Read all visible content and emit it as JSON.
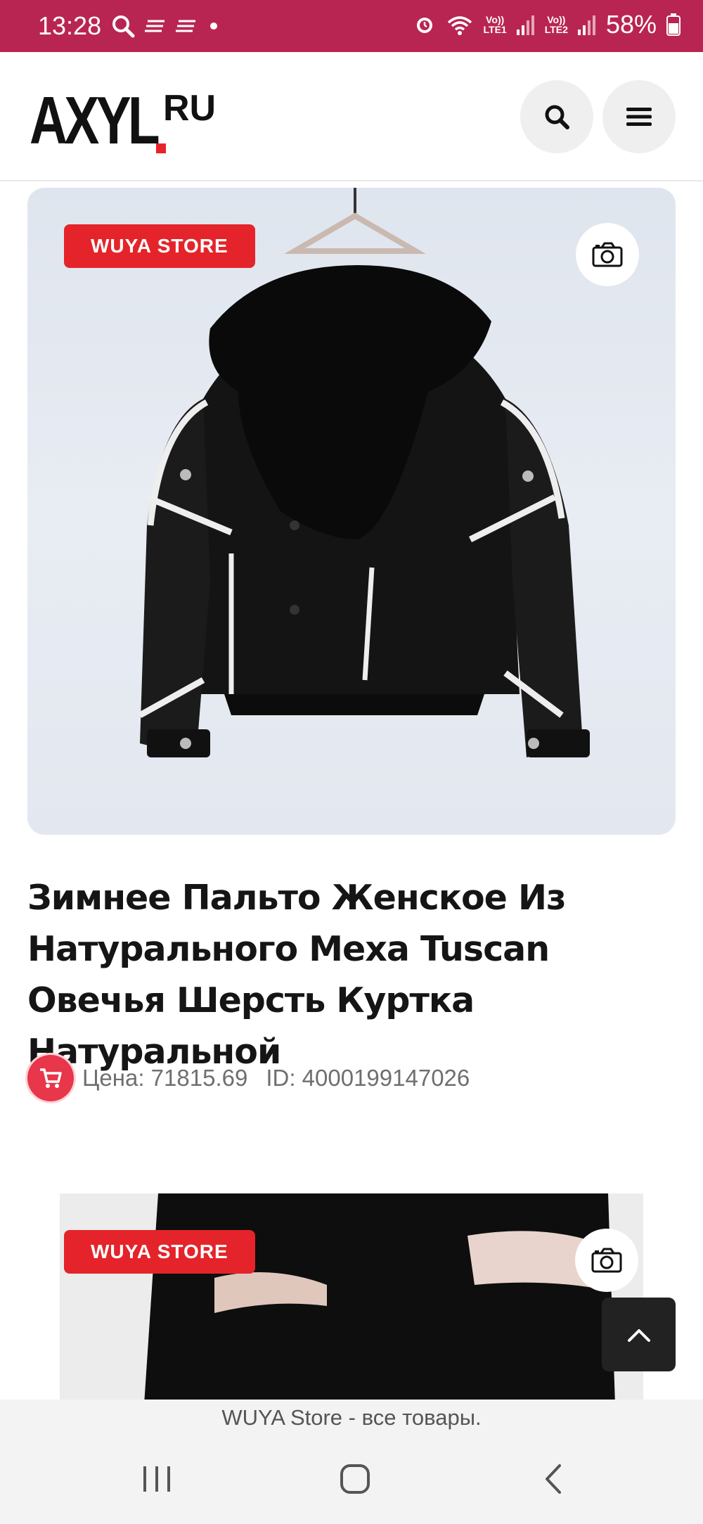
{
  "status_bar": {
    "time": "13:28",
    "lte1": "Vo))\nLTE1",
    "lte2": "Vo))\nLTE2",
    "battery": "58%",
    "icons": [
      "search-icon",
      "notification-lines-icon",
      "notification-lines-icon",
      "dot-icon",
      "alarm-icon",
      "wifi-icon",
      "signal-icon",
      "signal-icon",
      "battery-icon"
    ]
  },
  "header": {
    "logo_main": "AXYL",
    "logo_suffix": "RU",
    "search_icon": "search-icon",
    "menu_icon": "hamburger-icon"
  },
  "product": {
    "store_badge": "WUYA STORE",
    "camera_icon": "camera-icon",
    "title": "Зимнее Пальто Женское Из Натурального Меха Tuscan Овечья Шерсть Куртка Натуральной",
    "price_label": "Цена: 71815.69",
    "id_label": "ID: 4000199147026",
    "cart_icon": "cart-icon"
  },
  "product2": {
    "store_badge": "WUYA STORE",
    "camera_icon": "camera-icon"
  },
  "scroll_top_icon": "chevron-up-icon",
  "bottom_link": "WUYA Store - все товары.",
  "nav": {
    "recent_icon": "recent-apps-icon",
    "home_icon": "home-icon",
    "back_icon": "back-icon"
  },
  "colors": {
    "status_bar": "#b92552",
    "accent": "#e4242a",
    "cart": "#e8364a"
  }
}
